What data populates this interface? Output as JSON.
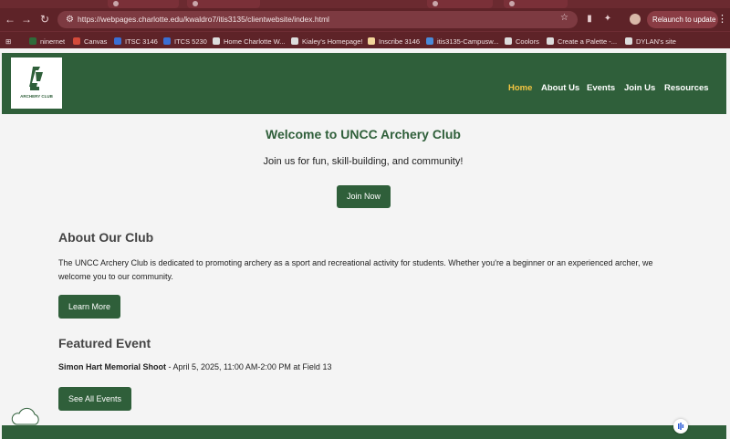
{
  "browser": {
    "url": "https://webpages.charlotte.edu/kwaldro7/itis3135/clientwebsite/index.html",
    "relaunch_label": "Relaunch to update",
    "bookmarks": [
      {
        "label": "ninernet",
        "color": "#2f6b3a"
      },
      {
        "label": "Canvas",
        "color": "#d44a3a"
      },
      {
        "label": "ITSC 3146",
        "color": "#3a6fd4"
      },
      {
        "label": "ITCS 5230",
        "color": "#3a6fd4"
      },
      {
        "label": "Home Charlotte W...",
        "color": "#dcdcdc"
      },
      {
        "label": "Kialey's Homepage!",
        "color": "#dcdcdc"
      },
      {
        "label": "Inscribe 3146",
        "color": "#f2d59a"
      },
      {
        "label": "itis3135-Campusw...",
        "color": "#4a8ad8"
      },
      {
        "label": "Coolors",
        "color": "#dcdcdc"
      },
      {
        "label": "Create a Palette -...",
        "color": "#dcdcdc"
      },
      {
        "label": "DYLAN's site",
        "color": "#dcdcdc"
      }
    ]
  },
  "site": {
    "logo_text": "ARCHERY CLUB",
    "nav": [
      "Home",
      "About Us",
      "Events",
      "Join Us",
      "Resources"
    ],
    "active_nav": "Home",
    "colors": {
      "brand": "#2f5f3a",
      "accent": "#f4c542"
    }
  },
  "hero": {
    "title": "Welcome to UNCC Archery Club",
    "subtitle": "Join us for fun, skill-building, and community!",
    "button": "Join Now"
  },
  "about": {
    "title": "About Our Club",
    "text": "The UNCC Archery Club is dedicated to promoting archery as a sport and recreational activity for students. Whether you're a beginner or an experienced archer, we welcome you to our community.",
    "button": "Learn More"
  },
  "event": {
    "title": "Featured Event",
    "name": "Simon Hart Memorial Shoot",
    "details": " - April 5, 2025, 11:00 AM-2:00 PM at Field 13",
    "button": "See All Events"
  }
}
